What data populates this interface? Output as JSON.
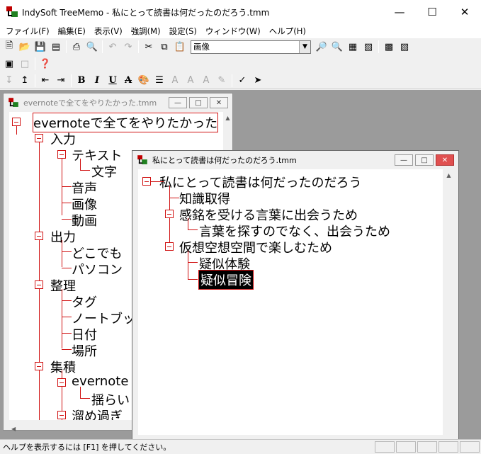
{
  "window": {
    "title": "IndySoft TreeMemo - 私にとって読書は何だったのだろう.tmm"
  },
  "menu": [
    "ファイル(F)",
    "編集(E)",
    "表示(V)",
    "強調(M)",
    "設定(S)",
    "ウィンドウ(W)",
    "ヘルプ(H)"
  ],
  "toolbar": {
    "style_combo_value": "画像"
  },
  "window1": {
    "title": "evernoteで全てをやりたかった.tmm",
    "nodes": [
      "evernoteで全てをやりたかった",
      "入力",
      "テキスト",
      "文字",
      "音声",
      "画像",
      "動画",
      "出力",
      "どこでも",
      "パソコン",
      "整理",
      "タグ",
      "ノートブック",
      "日付",
      "場所",
      "集積",
      "evernote",
      "揺らい",
      "溜め過ぎ"
    ]
  },
  "window2": {
    "title": "私にとって読書は何だったのだろう.tmm",
    "nodes": [
      "私にとって読書は何だったのだろう",
      "知識取得",
      "感銘を受ける言葉に出会うため",
      "言葉を探すのでなく、出会うため",
      "仮想空想空間で楽しむため",
      "疑似体験",
      "疑似冒険"
    ]
  },
  "statusbar": {
    "text": "ヘルプを表示するには [F1] を押してください。"
  }
}
